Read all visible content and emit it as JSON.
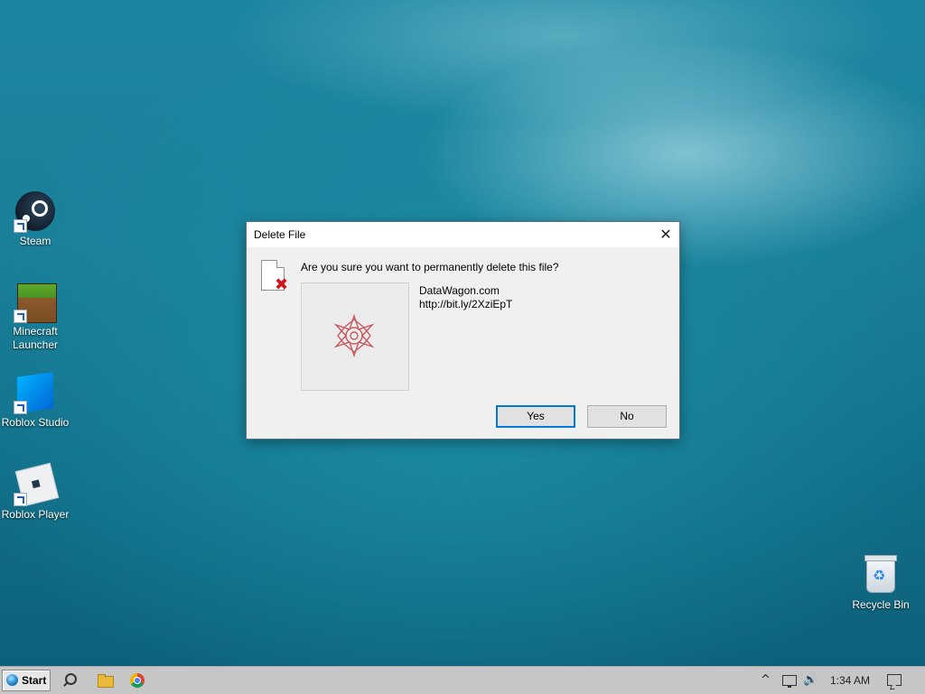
{
  "desktop": {
    "icons": [
      {
        "label": "Steam",
        "icon": "steam-icon"
      },
      {
        "label": "Minecraft Launcher",
        "icon": "minecraft-icon"
      },
      {
        "label": "Roblox Studio",
        "icon": "roblox-studio-icon"
      },
      {
        "label": "Roblox Player",
        "icon": "roblox-player-icon"
      },
      {
        "label": "Recycle Bin",
        "icon": "recycle-bin-icon"
      }
    ]
  },
  "dialog": {
    "title": "Delete File",
    "question": "Are you sure you want to permanently delete this file?",
    "file_name": "DataWagon.com",
    "file_link": "http://bit.ly/2XziEpT",
    "yes_label": "Yes",
    "no_label": "No",
    "close_glyph": "✕",
    "warning_glyph": "✖"
  },
  "taskbar": {
    "start_label": "Start",
    "tray_chevron": "^",
    "volume_glyph": "🔊",
    "clock": "1:34 AM"
  },
  "colors": {
    "accent": "#0078d7",
    "delete_red": "#d0141e",
    "taskbar_bg": "#c6c6c6"
  }
}
